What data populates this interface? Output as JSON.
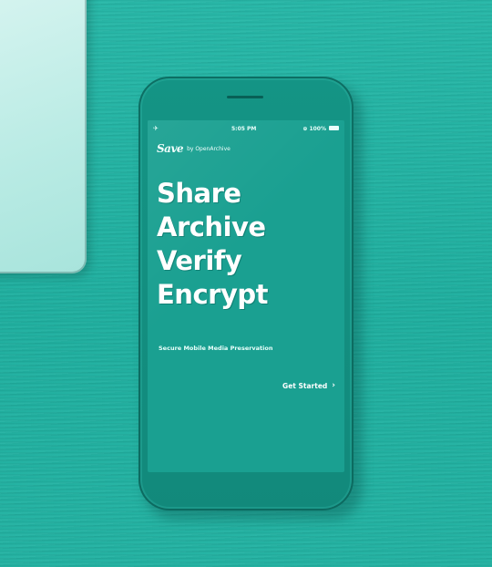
{
  "status_bar": {
    "signal": "✈",
    "time": "5:05 PM",
    "battery": "⊕ 100%"
  },
  "brand": {
    "logo_text": "Save",
    "by": "by OpenArchive"
  },
  "headline": [
    "Share",
    "Archive",
    "Verify",
    "Encrypt"
  ],
  "tagline": "Secure Mobile Media Preservation",
  "cta": {
    "label": "Get Started",
    "chevron": "›"
  },
  "colors": {
    "background": "#22b3a3",
    "screen": "#1aa091",
    "text": "#ffffff"
  }
}
